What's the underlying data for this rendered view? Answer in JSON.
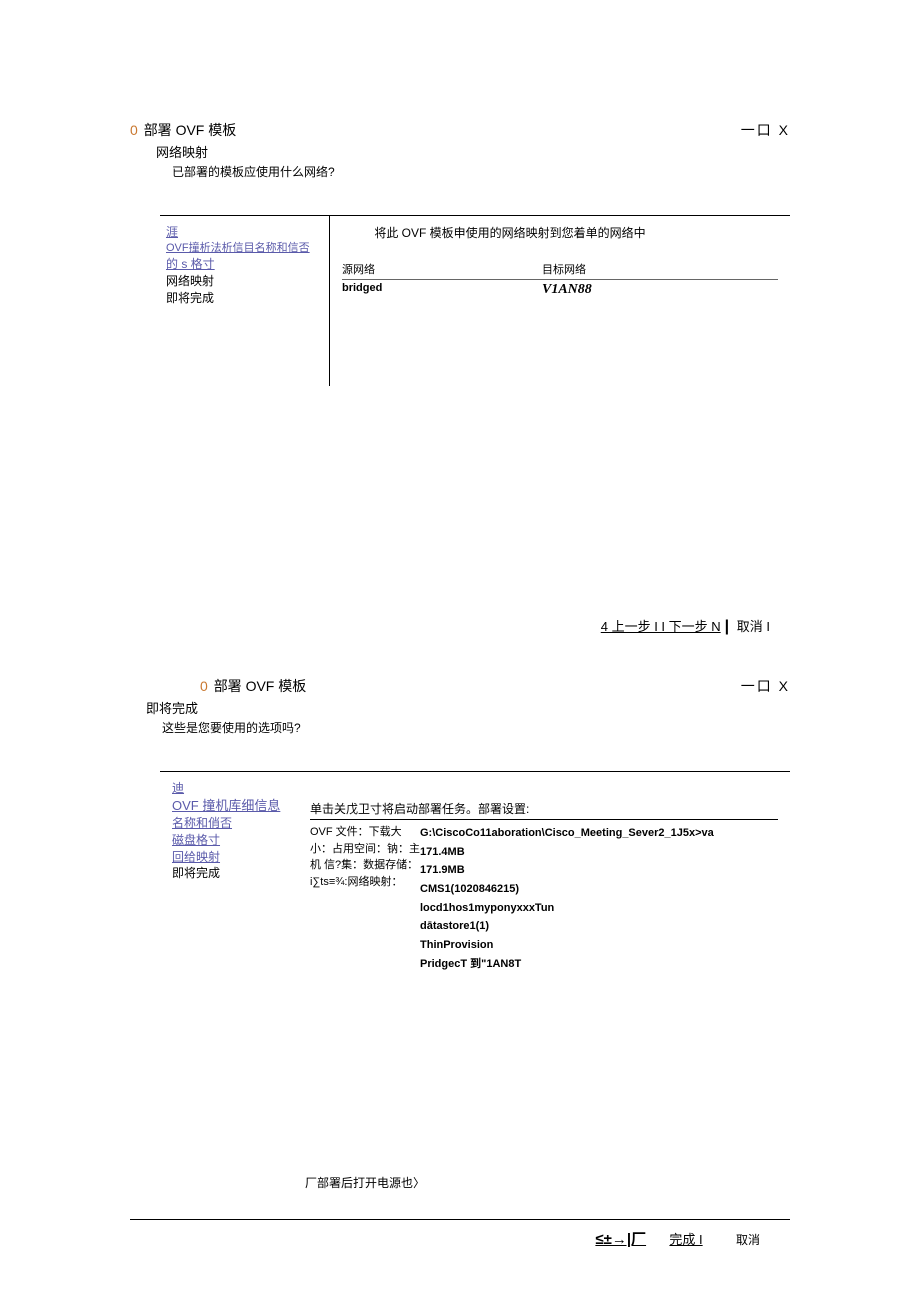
{
  "window1": {
    "icon": "0",
    "title": "部署 OVF 模板",
    "controls": "一口 X",
    "section_title": "网络映射",
    "section_desc": "已部署的模板应使用什么网络?",
    "sidebar": {
      "items": [
        "涯",
        "OVF撞析法析信目名称和信否",
        "的 s 格寸",
        "网络映射",
        "即将完成"
      ]
    },
    "instruction": "将此 OVF 模板申使用的网络映射到您着单的网络中",
    "table": {
      "headers": [
        "源网络",
        "目标网络"
      ],
      "row": [
        "bridged",
        "V1AN88"
      ]
    },
    "footer": "4 上一步 I I 下一步 N",
    "cancel": "取消 I"
  },
  "window2": {
    "icon": "0",
    "title": "部署 OVF 模板",
    "controls": "一口 X",
    "section_title": "即将完成",
    "section_desc": "这些是您要使用的选项吗?",
    "sidebar": {
      "items": [
        "迪",
        "OVF 撞机库细信息",
        "名称和俏否",
        "磁盘格寸",
        "回给映射",
        "即将完成"
      ]
    },
    "instruction": "单击关戊卫寸将启动部署任务。部署设置:",
    "settings": {
      "labels": "OVF 文件：下载大小：占用空间：钠：主机 信?集：数据存储：i∑ts≡¾:网络映射：",
      "values": [
        "G:\\CiscoCo11aboration\\Cisco_Meeting_Sever2_1J5x>va",
        "171.4MB",
        "171.9MB",
        "CMS1(1020846215)",
        "locd1hos1myponyxxxTun",
        "dātastore1(1)",
        "ThinProvision",
        "PridgecT 到\"1AN8T"
      ]
    },
    "checkbox_label": "厂部署后打开电源也〉",
    "footer": {
      "arrows": "≤±→|厂",
      "finish": "完成 I",
      "cancel": "取消"
    }
  }
}
